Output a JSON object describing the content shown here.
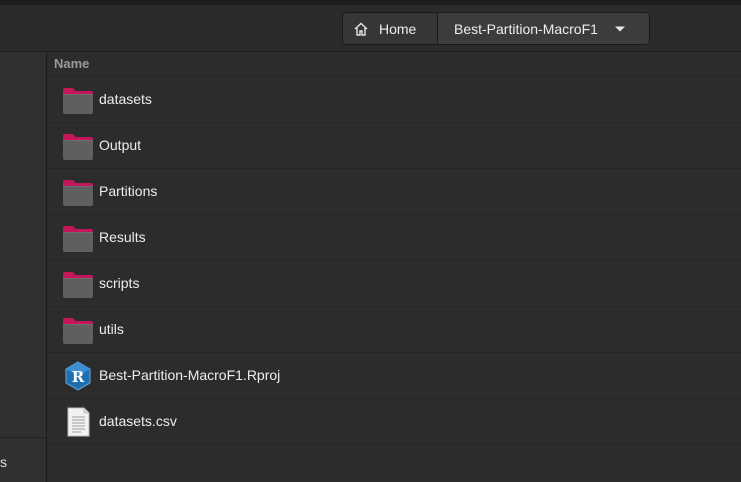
{
  "header": {
    "breadcrumb": [
      {
        "label": "Home",
        "icon": "home-icon"
      },
      {
        "label": "Best-Partition-MacroF1",
        "icon": "chevron-down-icon"
      }
    ]
  },
  "sidebar": {
    "partial_label": "s"
  },
  "list": {
    "column_header": "Name",
    "items": [
      {
        "name": "datasets",
        "type": "folder",
        "icon": "folder-icon"
      },
      {
        "name": "Output",
        "type": "folder",
        "icon": "folder-icon"
      },
      {
        "name": "Partitions",
        "type": "folder",
        "icon": "folder-icon"
      },
      {
        "name": "Results",
        "type": "folder",
        "icon": "folder-icon"
      },
      {
        "name": "scripts",
        "type": "folder",
        "icon": "folder-icon"
      },
      {
        "name": "utils",
        "type": "folder",
        "icon": "folder-icon"
      },
      {
        "name": "Best-Partition-MacroF1.Rproj",
        "type": "rproj",
        "icon": "r-project-icon"
      },
      {
        "name": "datasets.csv",
        "type": "csv",
        "icon": "text-file-icon"
      }
    ]
  },
  "colors": {
    "folder_tab": "#c2185b",
    "folder_body": "#5e5e5e",
    "r_blue": "#2c7fc1",
    "background": "#2c2c2c"
  }
}
